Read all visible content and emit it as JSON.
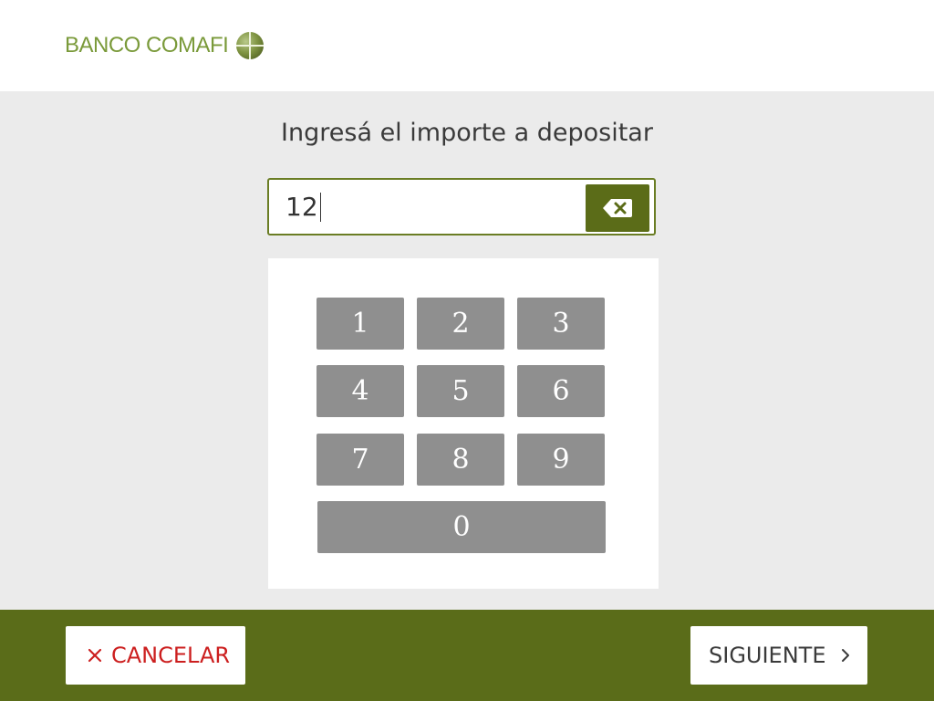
{
  "header": {
    "brand_name": "BANCO COMAFI",
    "logo_icon": "comafi-globe-icon",
    "brand_color": "#7a9a3a"
  },
  "prompt": {
    "title": "Ingresá el importe a depositar"
  },
  "amount_input": {
    "value": "12",
    "backspace_icon": "backspace-icon"
  },
  "keypad": {
    "keys": [
      "1",
      "2",
      "3",
      "4",
      "5",
      "6",
      "7",
      "8",
      "9",
      "0"
    ]
  },
  "footer": {
    "cancel_label": "CANCELAR",
    "cancel_icon": "close-icon",
    "next_label": "SIGUIENTE",
    "next_icon": "chevron-right-icon",
    "bar_color": "#5a6c19",
    "cancel_color": "#cc1f1f"
  }
}
